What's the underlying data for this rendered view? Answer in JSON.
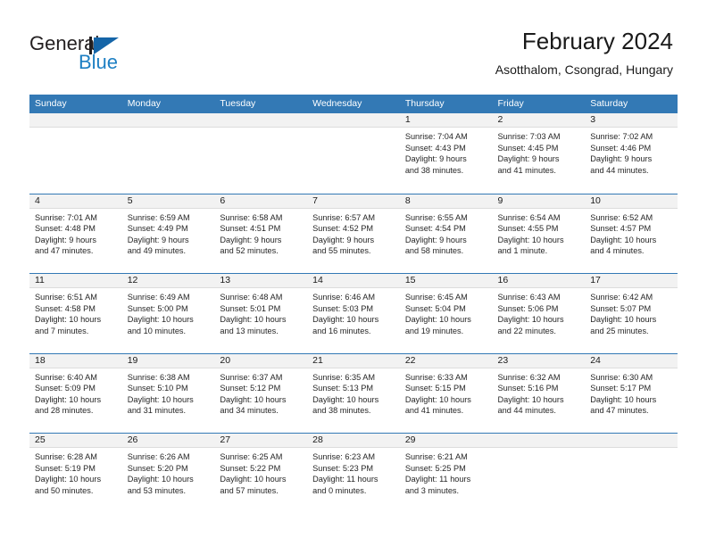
{
  "brand": {
    "name_part1": "General",
    "name_part2": "Blue",
    "accent_color": "#1d7fc3",
    "logo_icon": "triangle-flag-icon"
  },
  "header": {
    "title": "February 2024",
    "location": "Asotthalom, Csongrad, Hungary"
  },
  "calendar": {
    "header_bg": "#3379b5",
    "daynum_bg": "#f2f2f2",
    "weekdays": [
      "Sunday",
      "Monday",
      "Tuesday",
      "Wednesday",
      "Thursday",
      "Friday",
      "Saturday"
    ],
    "weeks": [
      [
        {
          "day": "",
          "lines": []
        },
        {
          "day": "",
          "lines": []
        },
        {
          "day": "",
          "lines": []
        },
        {
          "day": "",
          "lines": []
        },
        {
          "day": "1",
          "lines": [
            "Sunrise: 7:04 AM",
            "Sunset: 4:43 PM",
            "Daylight: 9 hours",
            "and 38 minutes."
          ]
        },
        {
          "day": "2",
          "lines": [
            "Sunrise: 7:03 AM",
            "Sunset: 4:45 PM",
            "Daylight: 9 hours",
            "and 41 minutes."
          ]
        },
        {
          "day": "3",
          "lines": [
            "Sunrise: 7:02 AM",
            "Sunset: 4:46 PM",
            "Daylight: 9 hours",
            "and 44 minutes."
          ]
        }
      ],
      [
        {
          "day": "4",
          "lines": [
            "Sunrise: 7:01 AM",
            "Sunset: 4:48 PM",
            "Daylight: 9 hours",
            "and 47 minutes."
          ]
        },
        {
          "day": "5",
          "lines": [
            "Sunrise: 6:59 AM",
            "Sunset: 4:49 PM",
            "Daylight: 9 hours",
            "and 49 minutes."
          ]
        },
        {
          "day": "6",
          "lines": [
            "Sunrise: 6:58 AM",
            "Sunset: 4:51 PM",
            "Daylight: 9 hours",
            "and 52 minutes."
          ]
        },
        {
          "day": "7",
          "lines": [
            "Sunrise: 6:57 AM",
            "Sunset: 4:52 PM",
            "Daylight: 9 hours",
            "and 55 minutes."
          ]
        },
        {
          "day": "8",
          "lines": [
            "Sunrise: 6:55 AM",
            "Sunset: 4:54 PM",
            "Daylight: 9 hours",
            "and 58 minutes."
          ]
        },
        {
          "day": "9",
          "lines": [
            "Sunrise: 6:54 AM",
            "Sunset: 4:55 PM",
            "Daylight: 10 hours",
            "and 1 minute."
          ]
        },
        {
          "day": "10",
          "lines": [
            "Sunrise: 6:52 AM",
            "Sunset: 4:57 PM",
            "Daylight: 10 hours",
            "and 4 minutes."
          ]
        }
      ],
      [
        {
          "day": "11",
          "lines": [
            "Sunrise: 6:51 AM",
            "Sunset: 4:58 PM",
            "Daylight: 10 hours",
            "and 7 minutes."
          ]
        },
        {
          "day": "12",
          "lines": [
            "Sunrise: 6:49 AM",
            "Sunset: 5:00 PM",
            "Daylight: 10 hours",
            "and 10 minutes."
          ]
        },
        {
          "day": "13",
          "lines": [
            "Sunrise: 6:48 AM",
            "Sunset: 5:01 PM",
            "Daylight: 10 hours",
            "and 13 minutes."
          ]
        },
        {
          "day": "14",
          "lines": [
            "Sunrise: 6:46 AM",
            "Sunset: 5:03 PM",
            "Daylight: 10 hours",
            "and 16 minutes."
          ]
        },
        {
          "day": "15",
          "lines": [
            "Sunrise: 6:45 AM",
            "Sunset: 5:04 PM",
            "Daylight: 10 hours",
            "and 19 minutes."
          ]
        },
        {
          "day": "16",
          "lines": [
            "Sunrise: 6:43 AM",
            "Sunset: 5:06 PM",
            "Daylight: 10 hours",
            "and 22 minutes."
          ]
        },
        {
          "day": "17",
          "lines": [
            "Sunrise: 6:42 AM",
            "Sunset: 5:07 PM",
            "Daylight: 10 hours",
            "and 25 minutes."
          ]
        }
      ],
      [
        {
          "day": "18",
          "lines": [
            "Sunrise: 6:40 AM",
            "Sunset: 5:09 PM",
            "Daylight: 10 hours",
            "and 28 minutes."
          ]
        },
        {
          "day": "19",
          "lines": [
            "Sunrise: 6:38 AM",
            "Sunset: 5:10 PM",
            "Daylight: 10 hours",
            "and 31 minutes."
          ]
        },
        {
          "day": "20",
          "lines": [
            "Sunrise: 6:37 AM",
            "Sunset: 5:12 PM",
            "Daylight: 10 hours",
            "and 34 minutes."
          ]
        },
        {
          "day": "21",
          "lines": [
            "Sunrise: 6:35 AM",
            "Sunset: 5:13 PM",
            "Daylight: 10 hours",
            "and 38 minutes."
          ]
        },
        {
          "day": "22",
          "lines": [
            "Sunrise: 6:33 AM",
            "Sunset: 5:15 PM",
            "Daylight: 10 hours",
            "and 41 minutes."
          ]
        },
        {
          "day": "23",
          "lines": [
            "Sunrise: 6:32 AM",
            "Sunset: 5:16 PM",
            "Daylight: 10 hours",
            "and 44 minutes."
          ]
        },
        {
          "day": "24",
          "lines": [
            "Sunrise: 6:30 AM",
            "Sunset: 5:17 PM",
            "Daylight: 10 hours",
            "and 47 minutes."
          ]
        }
      ],
      [
        {
          "day": "25",
          "lines": [
            "Sunrise: 6:28 AM",
            "Sunset: 5:19 PM",
            "Daylight: 10 hours",
            "and 50 minutes."
          ]
        },
        {
          "day": "26",
          "lines": [
            "Sunrise: 6:26 AM",
            "Sunset: 5:20 PM",
            "Daylight: 10 hours",
            "and 53 minutes."
          ]
        },
        {
          "day": "27",
          "lines": [
            "Sunrise: 6:25 AM",
            "Sunset: 5:22 PM",
            "Daylight: 10 hours",
            "and 57 minutes."
          ]
        },
        {
          "day": "28",
          "lines": [
            "Sunrise: 6:23 AM",
            "Sunset: 5:23 PM",
            "Daylight: 11 hours",
            "and 0 minutes."
          ]
        },
        {
          "day": "29",
          "lines": [
            "Sunrise: 6:21 AM",
            "Sunset: 5:25 PM",
            "Daylight: 11 hours",
            "and 3 minutes."
          ]
        },
        {
          "day": "",
          "lines": []
        },
        {
          "day": "",
          "lines": []
        }
      ]
    ]
  }
}
